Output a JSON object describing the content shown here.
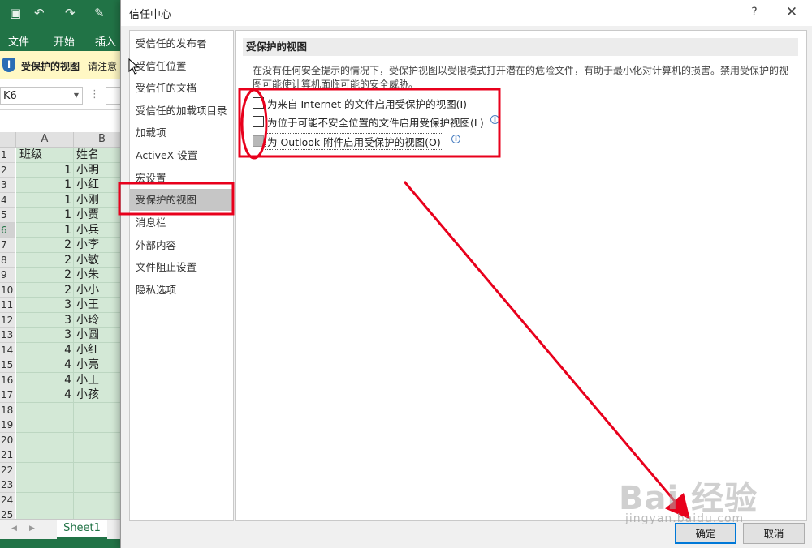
{
  "excel": {
    "ribbon_tabs": [
      "文件",
      "开始",
      "插入"
    ],
    "message_bar": {
      "title": "受保护的视图",
      "text": "请注意"
    },
    "name_box": "K6",
    "columns": [
      "A",
      "B"
    ],
    "rows": [
      {
        "n": "1",
        "a": "班级",
        "b": "姓名"
      },
      {
        "n": "2",
        "a": "1",
        "b": "小明"
      },
      {
        "n": "3",
        "a": "1",
        "b": "小红"
      },
      {
        "n": "4",
        "a": "1",
        "b": "小刚"
      },
      {
        "n": "5",
        "a": "1",
        "b": "小贾"
      },
      {
        "n": "6",
        "a": "1",
        "b": "小兵"
      },
      {
        "n": "7",
        "a": "2",
        "b": "小李"
      },
      {
        "n": "8",
        "a": "2",
        "b": "小敏"
      },
      {
        "n": "9",
        "a": "2",
        "b": "小朱"
      },
      {
        "n": "10",
        "a": "2",
        "b": "小小"
      },
      {
        "n": "11",
        "a": "3",
        "b": "小王"
      },
      {
        "n": "12",
        "a": "3",
        "b": "小玲"
      },
      {
        "n": "13",
        "a": "3",
        "b": "小圆"
      },
      {
        "n": "14",
        "a": "4",
        "b": "小红"
      },
      {
        "n": "15",
        "a": "4",
        "b": "小亮"
      },
      {
        "n": "16",
        "a": "4",
        "b": "小王"
      },
      {
        "n": "17",
        "a": "4",
        "b": "小孩"
      },
      {
        "n": "18",
        "a": "",
        "b": ""
      },
      {
        "n": "19",
        "a": "",
        "b": ""
      },
      {
        "n": "20",
        "a": "",
        "b": ""
      },
      {
        "n": "21",
        "a": "",
        "b": ""
      },
      {
        "n": "22",
        "a": "",
        "b": ""
      },
      {
        "n": "23",
        "a": "",
        "b": ""
      },
      {
        "n": "24",
        "a": "",
        "b": ""
      },
      {
        "n": "25",
        "a": "",
        "b": ""
      }
    ],
    "sheet_tab": "Sheet1"
  },
  "dialog": {
    "title": "信任中心",
    "help": "?",
    "close": "✕",
    "nav": [
      "受信任的发布者",
      "受信任位置",
      "受信任的文档",
      "受信任的加载项目录",
      "加载项",
      "ActiveX 设置",
      "宏设置",
      "受保护的视图",
      "消息栏",
      "外部内容",
      "文件阻止设置",
      "隐私选项"
    ],
    "active_nav": "受保护的视图",
    "section_title": "受保护的视图",
    "description": "在没有任何安全提示的情况下，受保护视图以受限模式打开潜在的危险文件，有助于最小化对计算机的损害。禁用受保护的视图可能使计算机面临可能的安全威胁。",
    "options": [
      {
        "label": "为来自 Internet 的文件启用受保护的视图(I)",
        "checked": false,
        "disabled": false,
        "info": false
      },
      {
        "label": "为位于可能不安全位置的文件启用受保护视图(L)",
        "checked": false,
        "disabled": false,
        "info": true
      },
      {
        "label": "为 Outlook 附件启用受保护的视图(O)",
        "checked": false,
        "disabled": true,
        "info": true
      }
    ],
    "ok_label": "确定",
    "cancel_label": "取消"
  },
  "watermark": {
    "logo": "Bai 经验",
    "url": "jingyan.baidu.com"
  },
  "colors": {
    "excel_green": "#217346",
    "annotation_red": "#e8001c",
    "selection_green": "#d3e8d6"
  }
}
